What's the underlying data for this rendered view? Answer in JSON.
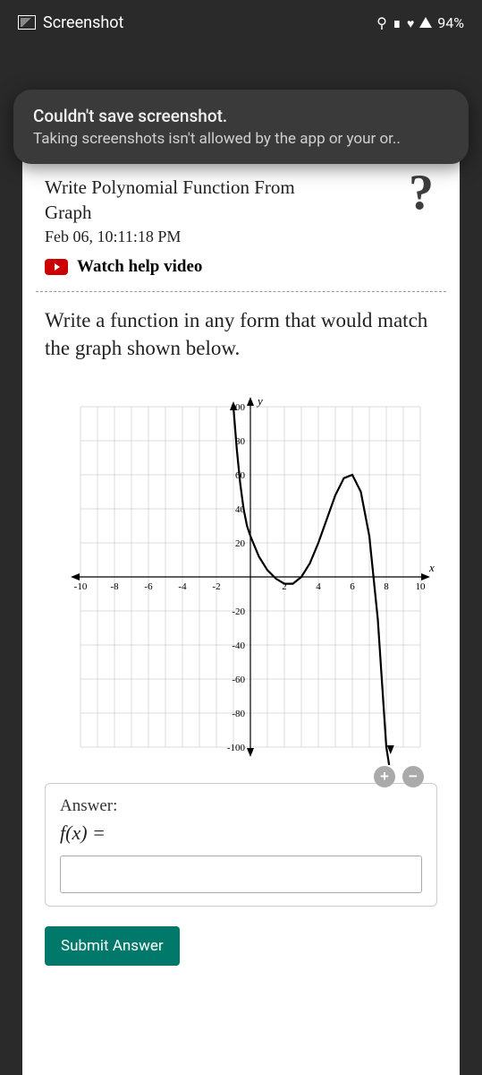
{
  "status_bar": {
    "title": "Screenshot",
    "battery_pct": "94%"
  },
  "toast": {
    "title": "Couldn't save screenshot.",
    "body": "Taking screenshots isn't allowed by the app or your or.."
  },
  "problem": {
    "title": "Write Polynomial Function From Graph",
    "timestamp": "Feb 06, 10:11:18 PM",
    "watch_label": "Watch help video",
    "instruction": "Write a function in any form that would match the graph shown below.",
    "answer_label": "Answer:",
    "fx_label": "f(x) =",
    "answer_value": "",
    "submit_label": "Submit Answer"
  },
  "chart_data": {
    "type": "line",
    "title": "",
    "xlabel": "x",
    "ylabel": "y",
    "xlim": [
      -10,
      10
    ],
    "ylim": [
      -100,
      100
    ],
    "x_ticks": [
      -10,
      -8,
      -6,
      -4,
      -2,
      2,
      4,
      6,
      8,
      10
    ],
    "y_ticks": [
      -100,
      -80,
      -60,
      -40,
      -20,
      20,
      40,
      60,
      80,
      100
    ],
    "series": [
      {
        "name": "f(x)",
        "x": [
          -1.0,
          -0.8,
          -0.6,
          -0.4,
          -0.2,
          0.0,
          0.5,
          1.0,
          1.5,
          2.0,
          2.5,
          3.0,
          3.5,
          4.0,
          4.5,
          5.0,
          5.5,
          6.0,
          6.5,
          7.0,
          7.5,
          8.0,
          8.25
        ],
        "values": [
          100,
          75,
          55,
          40,
          30,
          24,
          12,
          4,
          -1,
          -4,
          -4,
          0,
          8,
          20,
          34,
          48,
          58,
          60,
          50,
          24,
          -25,
          -100,
          -150
        ]
      }
    ],
    "notes": "Polynomial curve: enters from top-left near x≈-1, crosses x-axis near x≈2 (touching), turns, rises to local max ≈60 near x≈6, then falls steeply past x-axis near x≈7 toward -∞."
  }
}
